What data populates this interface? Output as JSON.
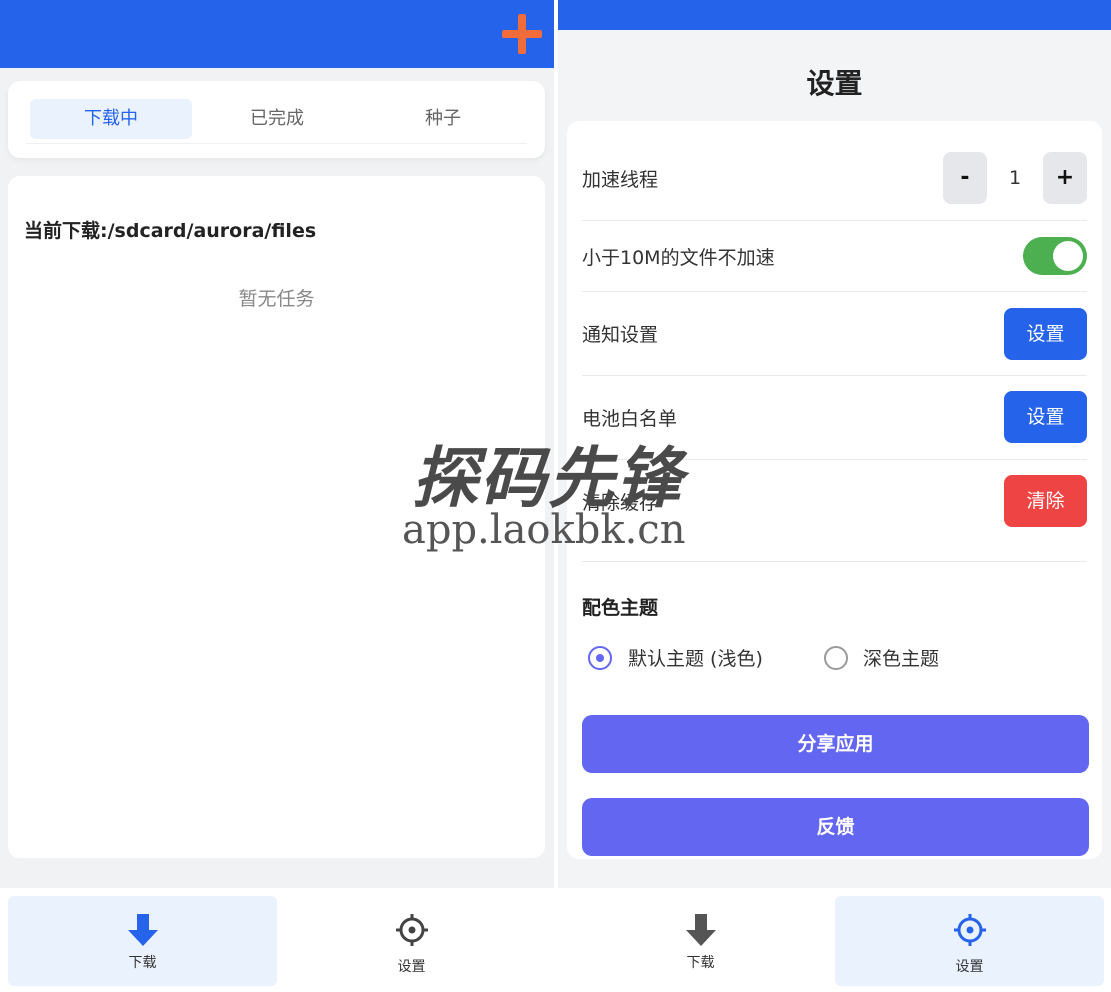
{
  "left": {
    "tabs": [
      {
        "label": "下载中",
        "active": true
      },
      {
        "label": "已完成",
        "active": false
      },
      {
        "label": "种子",
        "active": false
      }
    ],
    "download_path": "当前下载:/sdcard/aurora/files",
    "empty_text": "暂无任务",
    "nav": [
      {
        "label": "下载",
        "icon": "download-icon",
        "active": true
      },
      {
        "label": "设置",
        "icon": "settings-icon",
        "active": false
      }
    ]
  },
  "right": {
    "title": "设置",
    "accel_threads": {
      "label": "加速线程",
      "minus": "-",
      "value": "1",
      "plus": "+"
    },
    "small_file": {
      "label": "小于10M的文件不加速",
      "enabled": true
    },
    "notification": {
      "label": "通知设置",
      "button": "设置"
    },
    "battery": {
      "label": "电池白名单",
      "button": "设置"
    },
    "cache": {
      "label": "清除缓存",
      "button": "清除"
    },
    "theme": {
      "title": "配色主题",
      "options": [
        {
          "label": "默认主题 (浅色)",
          "selected": true
        },
        {
          "label": "深色主题",
          "selected": false
        }
      ]
    },
    "share_button": "分享应用",
    "feedback_button": "反馈",
    "nav": [
      {
        "label": "下载",
        "icon": "download-icon",
        "active": false
      },
      {
        "label": "设置",
        "icon": "settings-icon",
        "active": true
      }
    ]
  },
  "watermark": {
    "title": "探码先锋",
    "url": "app.laokbk.cn"
  },
  "colors": {
    "primary": "#2563eb",
    "accent_orange": "#f26b3a",
    "purple": "#6366f1",
    "danger": "#ef4444",
    "toggle_on": "#4caf50"
  }
}
